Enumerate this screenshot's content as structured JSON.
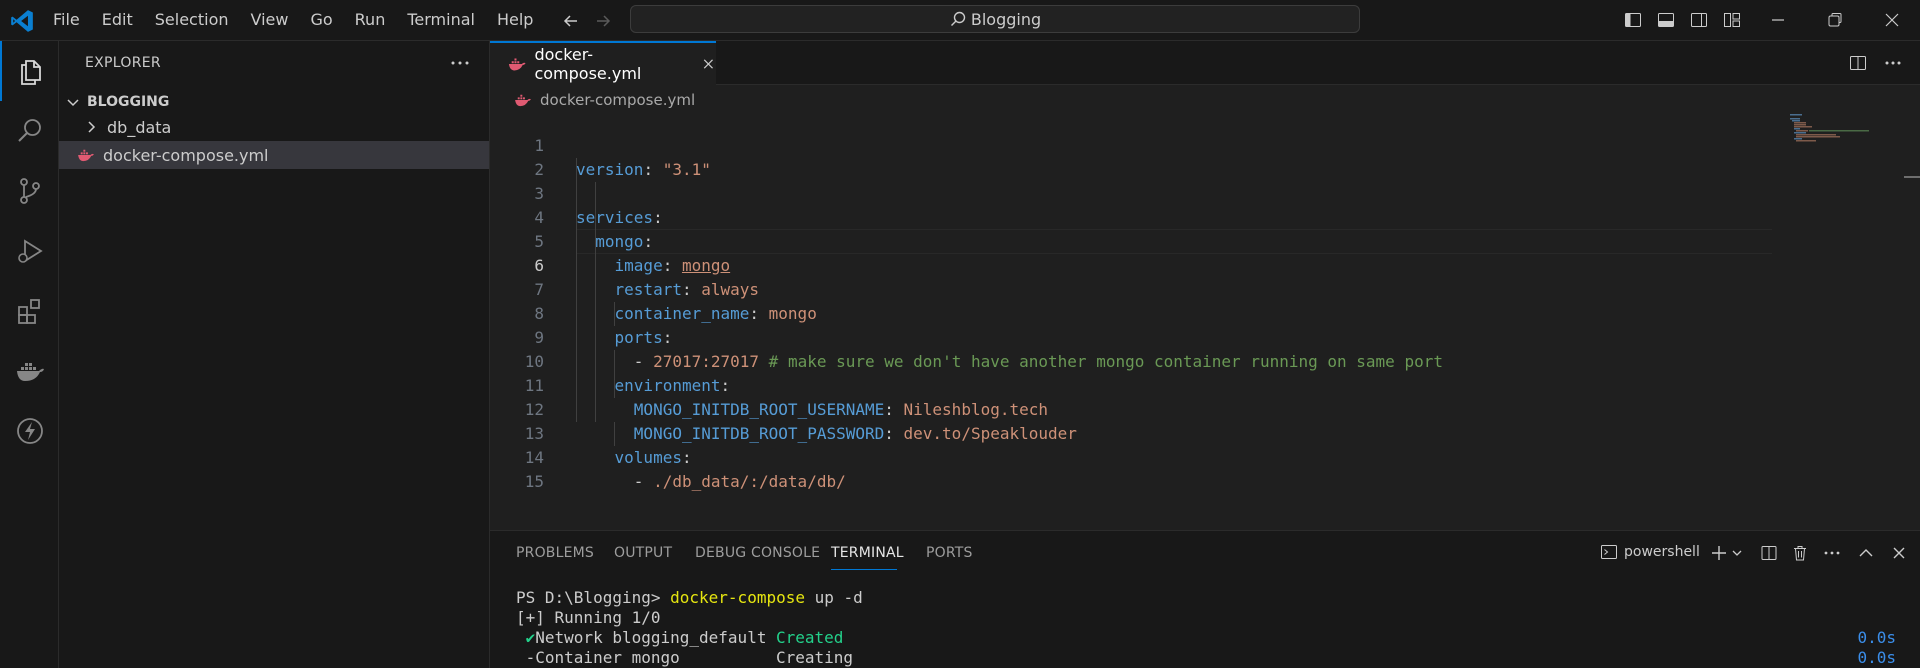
{
  "menu": [
    "File",
    "Edit",
    "Selection",
    "View",
    "Go",
    "Run",
    "Terminal",
    "Help"
  ],
  "search": {
    "text": "Blogging"
  },
  "sidebar": {
    "title": "EXPLORER",
    "section": "BLOGGING",
    "items": [
      {
        "label": "db_data",
        "type": "folder"
      },
      {
        "label": "docker-compose.yml",
        "type": "file"
      }
    ]
  },
  "editor": {
    "tab_label": "docker-compose.yml",
    "breadcrumb": "docker-compose.yml",
    "current_line": 6,
    "line_numbers": [
      "1",
      "2",
      "3",
      "4",
      "5",
      "6",
      "7",
      "8",
      "9",
      "10",
      "11",
      "12",
      "13",
      "14",
      "15"
    ],
    "lines": {
      "l1_key": "version",
      "l1_val": "\"3.1\"",
      "l3_key": "services",
      "l4_key": "mongo",
      "l5_key": "image",
      "l5_val": "mongo",
      "l6_key": "restart",
      "l6_val": "always",
      "l7_key": "container_name",
      "l7_val": "mongo",
      "l8_key": "ports",
      "l9_val": "27017:27017",
      "l9_comment": "# make sure we don't have another mongo container running on same port",
      "l10_key": "environment",
      "l11_key": "MONGO_INITDB_ROOT_USERNAME",
      "l11_val": "Nileshblog.tech",
      "l12_key": "MONGO_INITDB_ROOT_PASSWORD",
      "l12_val": "dev.to/Speaklouder",
      "l13_key": "volumes",
      "l14_val": "./db_data/:/data/db/"
    }
  },
  "panel": {
    "tabs": [
      "PROBLEMS",
      "OUTPUT",
      "DEBUG CONSOLE",
      "TERMINAL",
      "PORTS"
    ],
    "active_tab": "TERMINAL",
    "shell": "powershell",
    "terminal": {
      "prompt": "PS D:\\Blogging> ",
      "command": "docker-compose",
      "args": " up -d",
      "running": "[+] Running 1/0",
      "row1_mark": " ✔",
      "row1_name": "Network blogging_default",
      "row1_status": "Created",
      "row1_time": "0.0s",
      "row2_mark": " -",
      "row2_name": "Container mongo",
      "row2_status": "Creating",
      "row2_time": "0.0s"
    }
  },
  "colors": {
    "accent": "#0078d4",
    "keyword": "#569cd6",
    "string": "#ce9178",
    "number": "#b5cea8",
    "comment": "#6a9955"
  }
}
